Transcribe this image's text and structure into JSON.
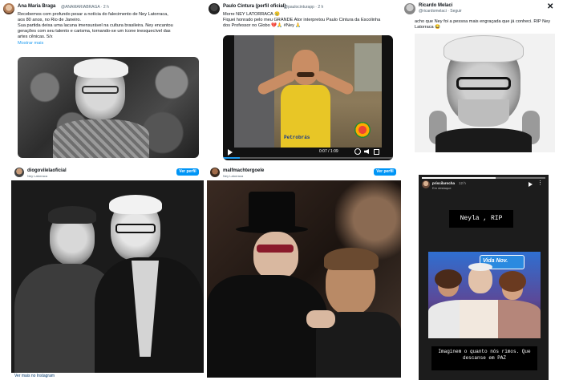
{
  "tweet1": {
    "name": "Ana Maria Braga",
    "handle": "@ANAMARIABRAGA · 2 h",
    "lines": [
      "Recebemos com profundo pesar a notícia do falecimento de Ney Latorraca,",
      "aos 80 anos, no Rio de Janeiro.",
      "Sua partida deixa uma lacuna imensurável na cultura brasileira. Ney encantou",
      "gerações com seu talento e carisma, tornando-se um ícone inesquecível das",
      "artes cênicas. 5/x"
    ],
    "show_more": "Mostrar mais"
  },
  "tweet2": {
    "name": "Paulo Cintura (perfil oficial)",
    "handle": "@paulocinturapp · 2 h",
    "line1": "Morre NEY LATORRACA 😢",
    "line2": "Fiquei honrado pelo meu GRANDE Ator interpretou Paulo Cintura da Escolinha",
    "line3": "dos Professor no Globo 💔🙏 #Ney 🙏",
    "video_time": "0:07 / 1:09",
    "shirt_text": "Petrobrás"
  },
  "tweet3": {
    "name": "Ricardo Melaci",
    "handle": "@ricardomelaci · Seguir",
    "text": "acho que Ney foi a pessoa mais engraçada que já conheci. RIP Ney Latorraca 😂",
    "close_icon": "close-icon"
  },
  "insta1": {
    "user": "diogovilelaoficial",
    "sub": "Ney Latorraca",
    "button": "Ver perfil",
    "footer": "Ver mais no Instagram"
  },
  "insta2": {
    "user": "malfmachtergoele",
    "sub": "Ney Latorraca",
    "button": "Ver perfil"
  },
  "story": {
    "user": "priscilarocha",
    "time": "12 h",
    "sub": "Em destaque",
    "label": "Neyla , RIP",
    "screen_text": "Vida Nov.",
    "caption": "Imaginem o quanto nós rimos. Que descanse em PAZ"
  },
  "colors": {
    "accent": "#1d9bf0",
    "insta_blue": "#0095f6",
    "story_bg": "#1c1c1c"
  }
}
